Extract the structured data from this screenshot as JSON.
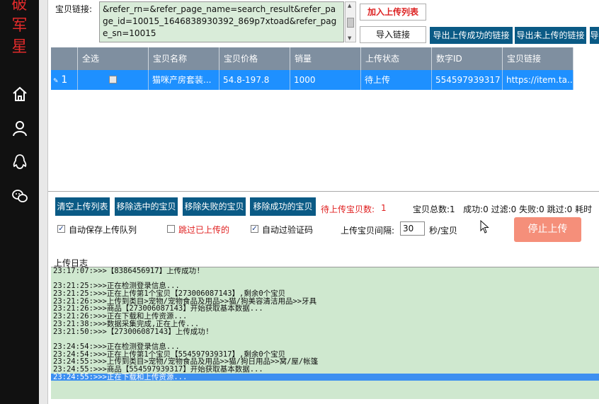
{
  "brand": {
    "chars": [
      "破",
      "军",
      "星"
    ]
  },
  "link_input": {
    "label": "宝贝链接:",
    "value": "&refer_rn=&refer_page_name=search_result&refer_page_id=10015_1646838930392_869p7xtoad&refer_page_sn=10015"
  },
  "buttons": {
    "add_to_list": "加入上传列表",
    "import_links": "导入链接",
    "export_success": "导出上传成功的链接",
    "export_pending": "导出未上传的链接",
    "export_more": "导"
  },
  "table": {
    "headers": [
      "",
      "全选",
      "宝贝名称",
      "宝贝价格",
      "销量",
      "上传状态",
      "数字ID",
      "宝贝链接"
    ],
    "rows": [
      {
        "index": "1",
        "name": "猫咪产房套装...",
        "price": "54.8-197.8",
        "sales": "1000",
        "status": "待上传",
        "id": "554597939317",
        "link": "https://item.ta..."
      }
    ]
  },
  "actions": {
    "clear": "清空上传列表",
    "remove_selected": "移除选中的宝贝",
    "remove_failed": "移除失败的宝贝",
    "remove_success": "移除成功的宝贝"
  },
  "stats": {
    "pending_label": "待上传宝贝数:",
    "pending_value": "1",
    "summary": "宝贝总数:1   成功:0 过滤:0 失败:0 跳过:0 耗时"
  },
  "options": {
    "auto_save": "自动保存上传队列",
    "skip_uploaded": "跳过已上传的",
    "auto_captcha": "自动过验证码",
    "interval_label": "上传宝贝间隔:",
    "interval_value": "30",
    "interval_unit": "秒/宝贝",
    "stop": "停止上传"
  },
  "log": {
    "title": "上传日志",
    "lines": [
      "23:17:07:>>>【8386456917】上传成功!",
      "",
      "23:21:25:>>>正在检测登录信息...",
      "23:21:25:>>>正在上传第1个宝贝【273006087143】,剩余0个宝贝",
      "23:21:26:>>>上传到类目>宠物/宠物食品及用品>>猫/狗美容清洁用品>>牙具",
      "23:21:26:>>>商品【273006087143】开始获取基本数据...",
      "23:21:26:>>>正在下载和上传资源...",
      "23:21:38:>>>数据采集完成,正在上传...",
      "23:21:50:>>>【273006087143】上传成功!",
      "",
      "23:24:54:>>>正在检测登录信息...",
      "23:24:54:>>>正在上传第1个宝贝【554597939317】,剩余0个宝贝",
      "23:24:55:>>>上传到类目>宠物/宠物食品及用品>>猫/狗日用品>>窝/屋/帐篷",
      "23:24:55:>>>商品【554597939317】开始获取基本数据...",
      "23:24:55:>>>正在下载和上传资源..."
    ]
  },
  "colors": {
    "accent_blue": "#0a5a85",
    "selection": "#1e90ff",
    "log_bg": "#cfe8cf",
    "stop_button": "#f58f7a",
    "brand_red": "#e12a2a"
  }
}
